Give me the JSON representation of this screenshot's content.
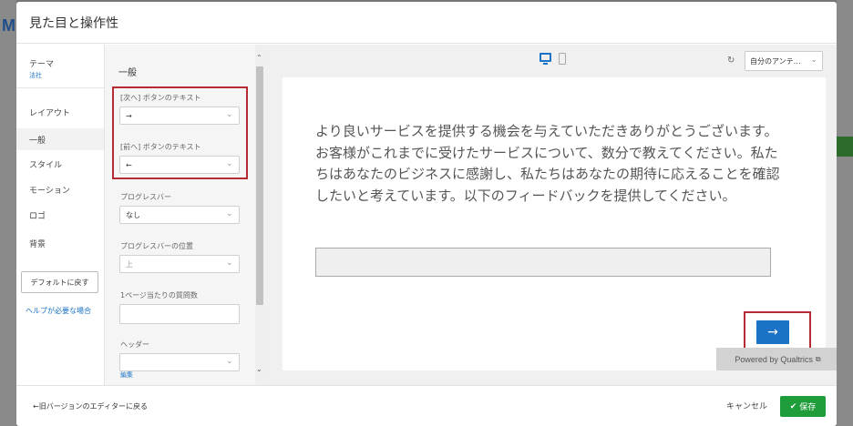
{
  "modal": {
    "title": "見た目と操作性"
  },
  "nav": {
    "theme_label": "テーマ",
    "theme_sub": "法社",
    "items": [
      "レイアウト",
      "一般",
      "スタイル",
      "モーション",
      "ロゴ",
      "背景"
    ],
    "reset_button": "デフォルトに戻す",
    "help_link": "ヘルプが必要な場合"
  },
  "settings": {
    "section_title": "一般",
    "next_label": "[次へ] ボタンのテキスト",
    "next_value": "→",
    "prev_label": "[前へ] ボタンのテキスト",
    "prev_value": "←",
    "progress_label": "プログレスバー",
    "progress_value": "なし",
    "progress_pos_label": "プログレスバーの位置",
    "progress_pos_value": "上",
    "questions_per_page_label": "1ページ当たりの質問数",
    "header_label": "ヘッダー",
    "edit_link": "編集"
  },
  "preview": {
    "language_select": "自分のアンテ…",
    "question_text": "より良いサービスを提供する機会を与えていただきありがとうございます。お客様がこれまでに受けたサービスについて、数分で教えてください。私たちはあなたのビジネスに感謝し、私たちはあなたの期待に応えることを確認したいと考えています。以下のフィードバックを提供してください。",
    "next_button": "→",
    "powered_by": "Powered by Qualtrics"
  },
  "footer": {
    "back_link": "←旧バージョンのエディターに戻る",
    "cancel": "キャンセル",
    "save": "保存"
  },
  "colors": {
    "accent": "#1a73c6",
    "highlight": "#b42b33",
    "save": "#1f9d3a"
  }
}
